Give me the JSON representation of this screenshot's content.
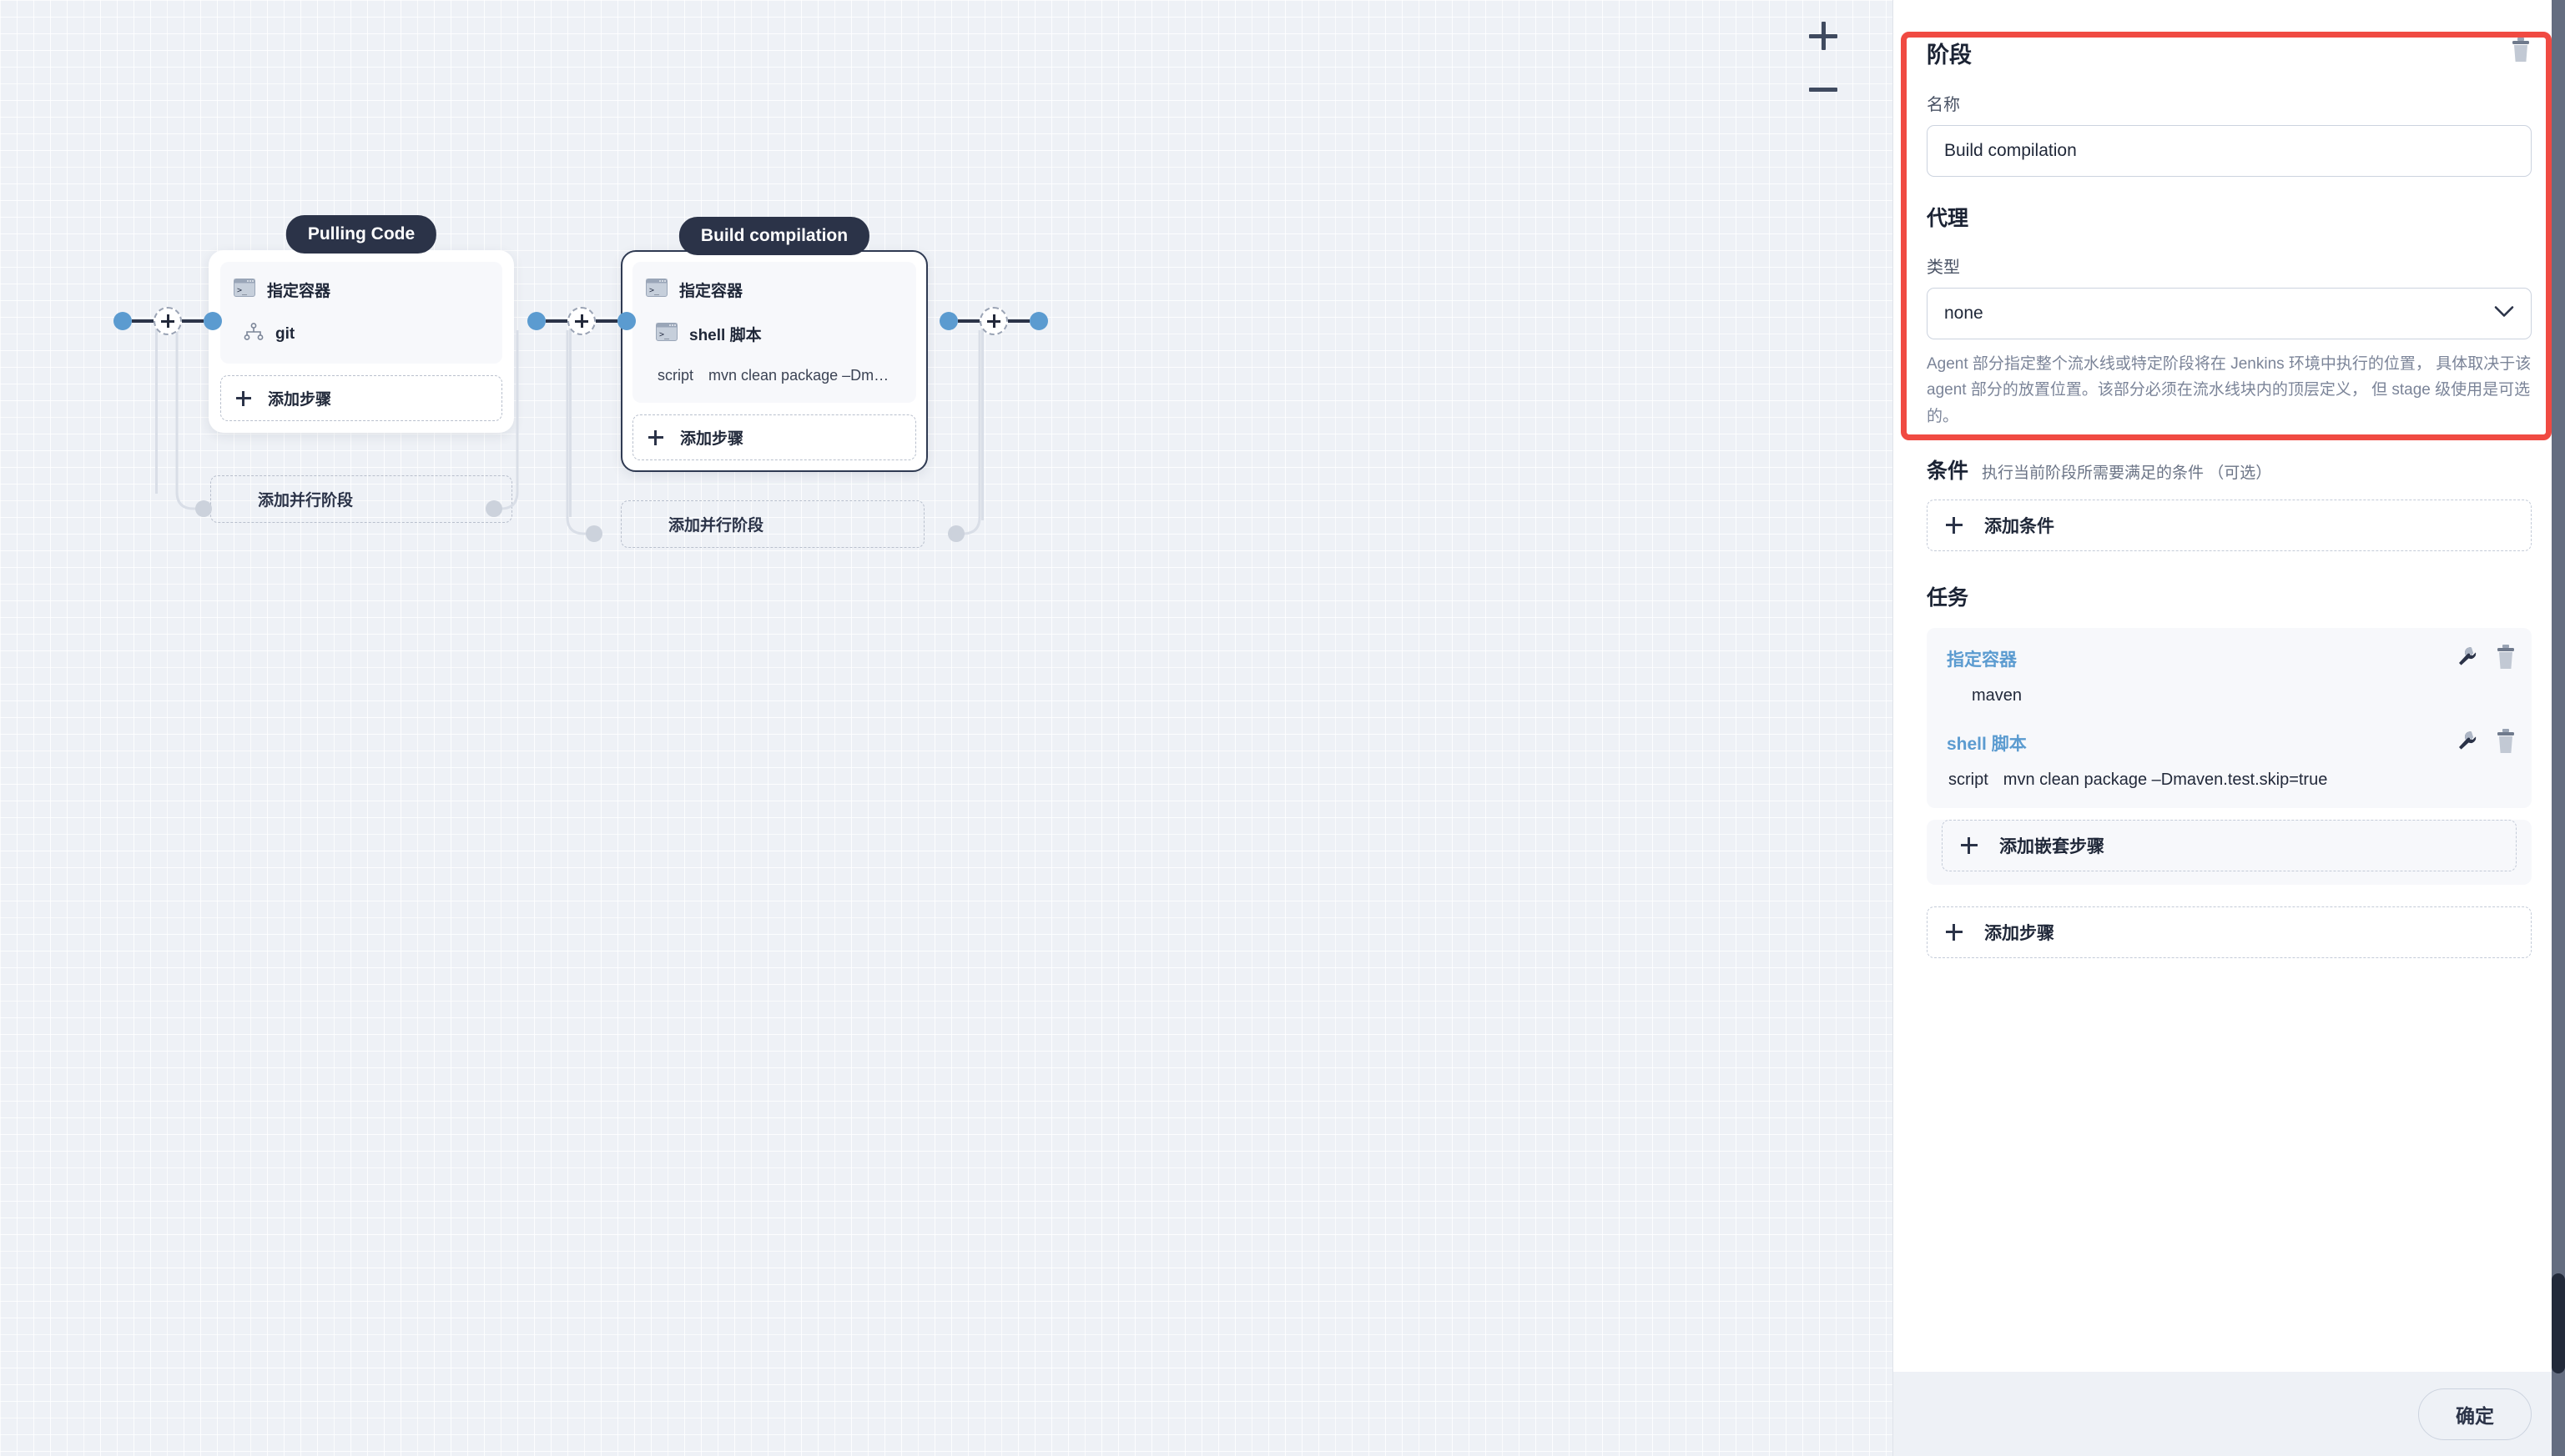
{
  "canvas": {
    "zoom_in_label": "+",
    "zoom_out_label": "−",
    "stages": [
      {
        "title": "Pulling Code",
        "selected": false,
        "steps": [
          {
            "icon": "terminal-icon",
            "label": "指定容器"
          },
          {
            "icon": "git-branch-icon",
            "label": "git"
          }
        ],
        "script": null,
        "add_step_label": "添加步骤",
        "add_parallel_label": "添加并行阶段"
      },
      {
        "title": "Build compilation",
        "selected": true,
        "steps": [
          {
            "icon": "terminal-icon",
            "label": "指定容器"
          },
          {
            "icon": "terminal-icon",
            "label": "shell 脚本"
          }
        ],
        "script": {
          "key": "script",
          "value": "mvn clean package –Dm…"
        },
        "add_step_label": "添加步骤",
        "add_parallel_label": "添加并行阶段"
      }
    ]
  },
  "panel": {
    "title": "阶段",
    "delete_icon": "trash-icon",
    "name_label": "名称",
    "name_value": "Build compilation",
    "name_placeholder": "",
    "agent_heading": "代理",
    "type_label": "类型",
    "type_value": "none",
    "type_options": [
      "none"
    ],
    "agent_help": "Agent 部分指定整个流水线或特定阶段将在 Jenkins 环境中执行的位置， 具体取决于该 agent 部分的放置位置。该部分必须在流水线块内的顶层定义， 但 stage 级使用是可选的。",
    "condition_heading": "条件",
    "condition_sub": "执行当前阶段所需要满足的条件 （可选）",
    "add_condition_label": "添加条件",
    "tasks_heading": "任务",
    "tasks": [
      {
        "name": "指定容器",
        "edit_icon": "wrench-icon",
        "delete_icon": "trash-icon",
        "value_key": "",
        "value": "maven"
      },
      {
        "name": "shell 脚本",
        "edit_icon": "wrench-icon",
        "delete_icon": "trash-icon",
        "value_key": "script",
        "value": "mvn clean package –Dmaven.test.skip=true"
      }
    ],
    "add_nested_step_label": "添加嵌套步骤",
    "add_step_label": "添加步骤",
    "confirm_label": "确定"
  },
  "annotation": {
    "highlight_color": "#f04a42"
  }
}
